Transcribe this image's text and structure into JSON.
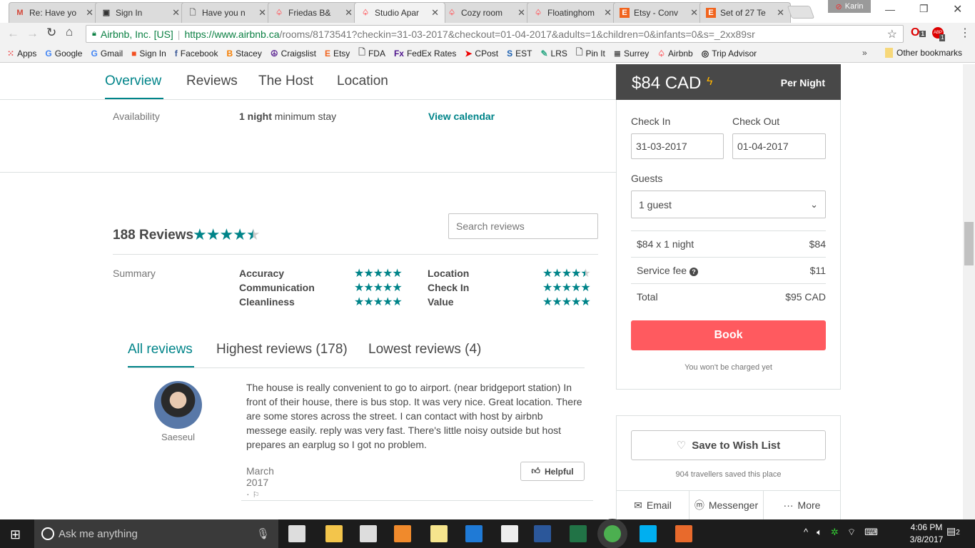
{
  "browser": {
    "tabs": [
      {
        "title": "Re: Have yo",
        "icon": "gmail-icon",
        "color": "#d44638"
      },
      {
        "title": "Sign In",
        "icon": "square-icon",
        "color": "#333"
      },
      {
        "title": "Have you n",
        "icon": "document-icon",
        "color": "#777"
      },
      {
        "title": "Friedas B&",
        "icon": "airbnb-icon",
        "color": "#ff5a5f"
      },
      {
        "title": "Studio Apar",
        "icon": "airbnb-icon",
        "color": "#ff5a5f",
        "active": true
      },
      {
        "title": "Cozy room",
        "icon": "airbnb-icon",
        "color": "#ff5a5f"
      },
      {
        "title": "Floatinghom",
        "icon": "airbnb-icon",
        "color": "#ff5a5f"
      },
      {
        "title": "Etsy - Conv",
        "icon": "etsy-icon",
        "color": "#f1641e"
      },
      {
        "title": "Set of 27 Te",
        "icon": "etsy-icon",
        "color": "#f1641e"
      }
    ],
    "profile": "Karin",
    "security_label": "Airbnb, Inc. [US]",
    "url_host": "https://www.airbnb.ca",
    "url_path": "/rooms/8173541?checkin=31-03-2017&checkout=01-04-2017&adults=1&children=0&infants=0&s=_2xx89sr",
    "ext_badges": [
      "1",
      "1"
    ],
    "bookmarks": [
      "Apps",
      "Google",
      "Gmail",
      "Sign In",
      "Facebook",
      "Stacey",
      "Craigslist",
      "Etsy",
      "FDA",
      "FedEx Rates",
      "CPost",
      "EST",
      "LRS",
      "Pin It",
      "Surrey",
      "Airbnb",
      "Trip Advisor"
    ],
    "bookmark_overflow": "»",
    "other_bookmarks": "Other bookmarks"
  },
  "page": {
    "nav": [
      "Overview",
      "Reviews",
      "The Host",
      "Location"
    ],
    "availability": {
      "label": "Availability",
      "value_bold": "1 night",
      "value_rest": " minimum stay",
      "link": "View calendar"
    },
    "reviews": {
      "title": "188 Reviews",
      "rating": 4.5,
      "search_placeholder": "Search reviews",
      "summary_label": "Summary",
      "categories": [
        {
          "name": "Accuracy",
          "rating": 5
        },
        {
          "name": "Communication",
          "rating": 5
        },
        {
          "name": "Cleanliness",
          "rating": 5
        },
        {
          "name": "Location",
          "rating": 4.5
        },
        {
          "name": "Check In",
          "rating": 5
        },
        {
          "name": "Value",
          "rating": 5
        }
      ],
      "filters": [
        "All reviews",
        "Highest reviews (178)",
        "Lowest reviews (4)"
      ],
      "items": [
        {
          "author": "Saeseul",
          "text": "The house is really convenient to go to airport. (near bridgeport station) In front of their house, there is bus stop. It was very nice. Great location. There are some stores across the street. I can contact with host by airbnb messege easily. reply was very fast. There's little noisy outside but host prepares an earplug so I got no problem.",
          "date": "March 2017 ·",
          "helpful": "Helpful"
        }
      ]
    },
    "booking": {
      "price": "$84 CAD",
      "per": "Per Night",
      "checkin_label": "Check In",
      "checkout_label": "Check Out",
      "checkin": "31-03-2017",
      "checkout": "01-04-2017",
      "guests_label": "Guests",
      "guests": "1 guest",
      "lines": [
        {
          "label": "$84 x 1 night",
          "value": "$84"
        },
        {
          "label": "Service fee",
          "value": "$11"
        },
        {
          "label": "Total",
          "value": "$95 CAD"
        }
      ],
      "book": "Book",
      "note": "You won't be charged yet",
      "accent": "#ff5a5f"
    },
    "wishlist": {
      "button": "Save to Wish List",
      "count": "904 travellers saved this place",
      "share": [
        "Email",
        "Messenger",
        "More"
      ]
    }
  },
  "taskbar": {
    "search": "Ask me anything",
    "time": "4:06 PM",
    "date": "3/8/2017",
    "notifications": "2"
  }
}
